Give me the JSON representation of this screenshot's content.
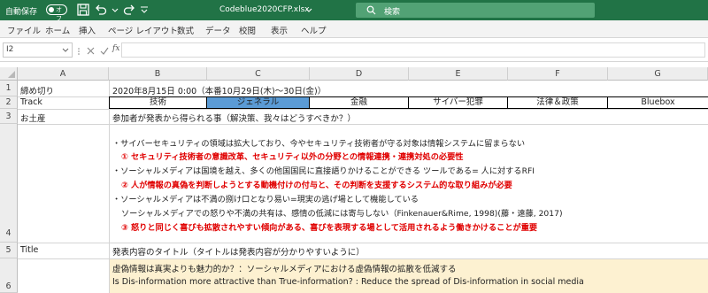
{
  "titlebar": {
    "autosave_label": "自動保存",
    "autosave_state": "オフ",
    "filename": "Codeblue2020CFP.xlsx",
    "search_placeholder": "検索"
  },
  "ribbon_tabs": [
    "ファイル",
    "ホーム",
    "挿入",
    "ページ レイアウト",
    "数式",
    "データ",
    "校閲",
    "表示",
    "ヘルプ"
  ],
  "formula_bar": {
    "name_box": "I2",
    "fx": "fx",
    "content": ""
  },
  "columns": [
    "A",
    "B",
    "C",
    "D",
    "E",
    "F",
    "G"
  ],
  "rows": [
    "1",
    "2",
    "3",
    "4",
    "5",
    "6"
  ],
  "cells": {
    "a1": "締め切り",
    "b1": "2020年8月15日 0:00（本番10月29日(木)〜30日(金)）",
    "a2": "Track",
    "tracks": [
      "技術",
      "ジェネラル",
      "金融",
      "サイバー犯罪",
      "法律＆政策",
      "Bluebox"
    ],
    "a3": "お土産",
    "b3": "参加者が発表から得られる事（解決策、我々はどうすべきか？）",
    "b4_lines": [
      "・サイバーセキュリティの領域は拡大しており、今やセキュリティ技術者が守る対象は情報システムに留まらない",
      "① セキュリティ技術者の意識改革、セキュリティ以外の分野との情報連携・連携対処の必要性",
      "・ソーシャルメディアは国境を越え、多くの他国国民に直接語りかけることができる ツールである= 人に対するRFI",
      "② 人が情報の真偽を判断しようとする動機付けの付与と、その判断を支援するシステム的な取り組みが必要",
      "・ソーシャルメディアは不満の捌け口となり易い=現実の逃げ場として機能している",
      "ソーシャルメディアでの怒りや不満の共有は、感情の低減には寄与しない（Finkenauer&Rime, 1998)(藤・遠藤, 2017)",
      "③ 怒りと同じく喜びも拡散されやすい傾向がある、喜びを表現する場として活用されるよう働きかけることが重要"
    ],
    "a5": "Title",
    "b5": "発表内容のタイトル（タイトルは発表内容が分かりやすいように）",
    "b6_line1": "虚偽情報は真実よりも魅力的か？：ソーシャルメディアにおける虚偽情報の拡散を低減する",
    "b6_line2": "Is Dis-information more attractive than True-information? : Reduce the spread of Dis-information in social media"
  },
  "colors": {
    "excel_green": "#217346",
    "highlight_fill": "#fdf1d1",
    "selected_track": "#5b9bd5",
    "red_text": "#e00000"
  }
}
